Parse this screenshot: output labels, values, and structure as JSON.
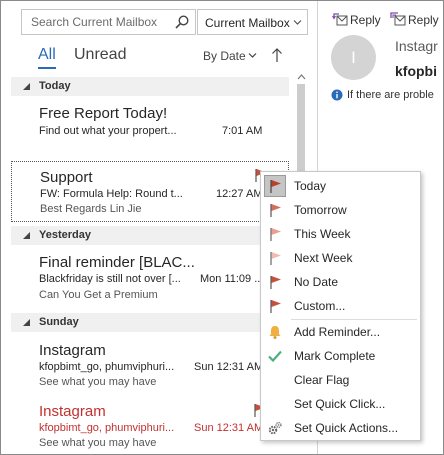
{
  "search": {
    "placeholder": "Search Current Mailbox",
    "scope": "Current Mailbox"
  },
  "filters": {
    "all": "All",
    "unread": "Unread",
    "sort": "By Date"
  },
  "groups": [
    {
      "label": "Today"
    },
    {
      "label": "Yesterday"
    },
    {
      "label": "Sunday"
    }
  ],
  "mails": [
    {
      "sender": "Free Report Today!",
      "subject": "Find out what your propert...",
      "time": "7:01 AM",
      "preview": ""
    },
    {
      "sender": "Support",
      "subject": "FW: Formula Help: Round t...",
      "time": "12:27 AM",
      "preview": "Best Regards  Lin Jie",
      "flagged": true
    },
    {
      "sender": "Final reminder [BLAC...",
      "subject": "Blackfriday is still not over [...",
      "time": "Mon 11:09 ...",
      "preview": "Can You Get a Premium"
    },
    {
      "sender": "Instagram",
      "subject": "kfopbimt_go, phumviphuri...",
      "time": "Sun 12:31 AM",
      "preview": "See what you may have"
    },
    {
      "sender": "Instagram",
      "subject": "kfopbimt_go, phumviphuri...",
      "time": "Sun 12:31 AM",
      "preview": "See what you may have",
      "unread": true,
      "flagged": true
    }
  ],
  "reading": {
    "reply": "Reply",
    "reply_all": "Reply",
    "avatar_initial": "I",
    "sender": "Instagr",
    "to": "kfopbi",
    "info": "If there are proble"
  },
  "context_menu": {
    "items": [
      {
        "label": "Today",
        "icon": "flag-dark-icon"
      },
      {
        "label": "Tomorrow",
        "icon": "flag-icon"
      },
      {
        "label": "This Week",
        "icon": "flag-light-icon"
      },
      {
        "label": "Next Week",
        "icon": "flag-light-icon"
      },
      {
        "label": "No Date",
        "icon": "flag-icon"
      },
      {
        "label": "Custom...",
        "icon": "flag-icon"
      },
      {
        "label": "Add Reminder...",
        "icon": "bell-icon"
      },
      {
        "label": "Mark Complete",
        "icon": "checkmark-icon"
      },
      {
        "label": "Clear Flag",
        "icon": ""
      },
      {
        "label": "Set Quick Click...",
        "icon": ""
      },
      {
        "label": "Set Quick Actions...",
        "icon": "gear-icon"
      }
    ]
  },
  "colors": {
    "accent": "#2b6ab7",
    "flag": "#c3533f",
    "flag_light": "#e8a092",
    "unread_red": "#c3302f",
    "group_bg": "#f0f0f0",
    "check_green": "#4fae7e",
    "bell": "#f0b040"
  }
}
